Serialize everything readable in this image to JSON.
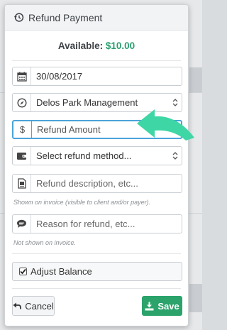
{
  "dialog": {
    "title": "Refund Payment",
    "available_label": "Available:",
    "available_amount": "$10.00"
  },
  "form": {
    "date_value": "30/08/2017",
    "company_value": "Delos Park Management",
    "amount_prefix": "$",
    "amount_placeholder": "Refund Amount",
    "method_placeholder": "Select refund method...",
    "description_placeholder": "Refund description, etc...",
    "description_hint": "Shown on invoice (visible to client and/or payer).",
    "reason_placeholder": "Reason for refund, etc...",
    "reason_hint": "Not shown on invoice.",
    "adjust_balance_label": "Adjust Balance",
    "adjust_balance_checked": true
  },
  "buttons": {
    "cancel_label": "Cancel",
    "save_label": "Save"
  },
  "colors": {
    "accent_green": "#2ba36b",
    "available_green": "#2a9d6f",
    "focus_blue": "#4ba3d9",
    "annotation_arrow": "#3fd6a6"
  },
  "icons": {
    "header": "refund-history-icon",
    "date": "calendar-icon",
    "company": "compass-icon",
    "method": "wallet-icon",
    "description": "invoice-document-icon",
    "reason": "speech-bubble-icon",
    "cancel": "undo-arrow-icon",
    "save": "download-icon"
  }
}
